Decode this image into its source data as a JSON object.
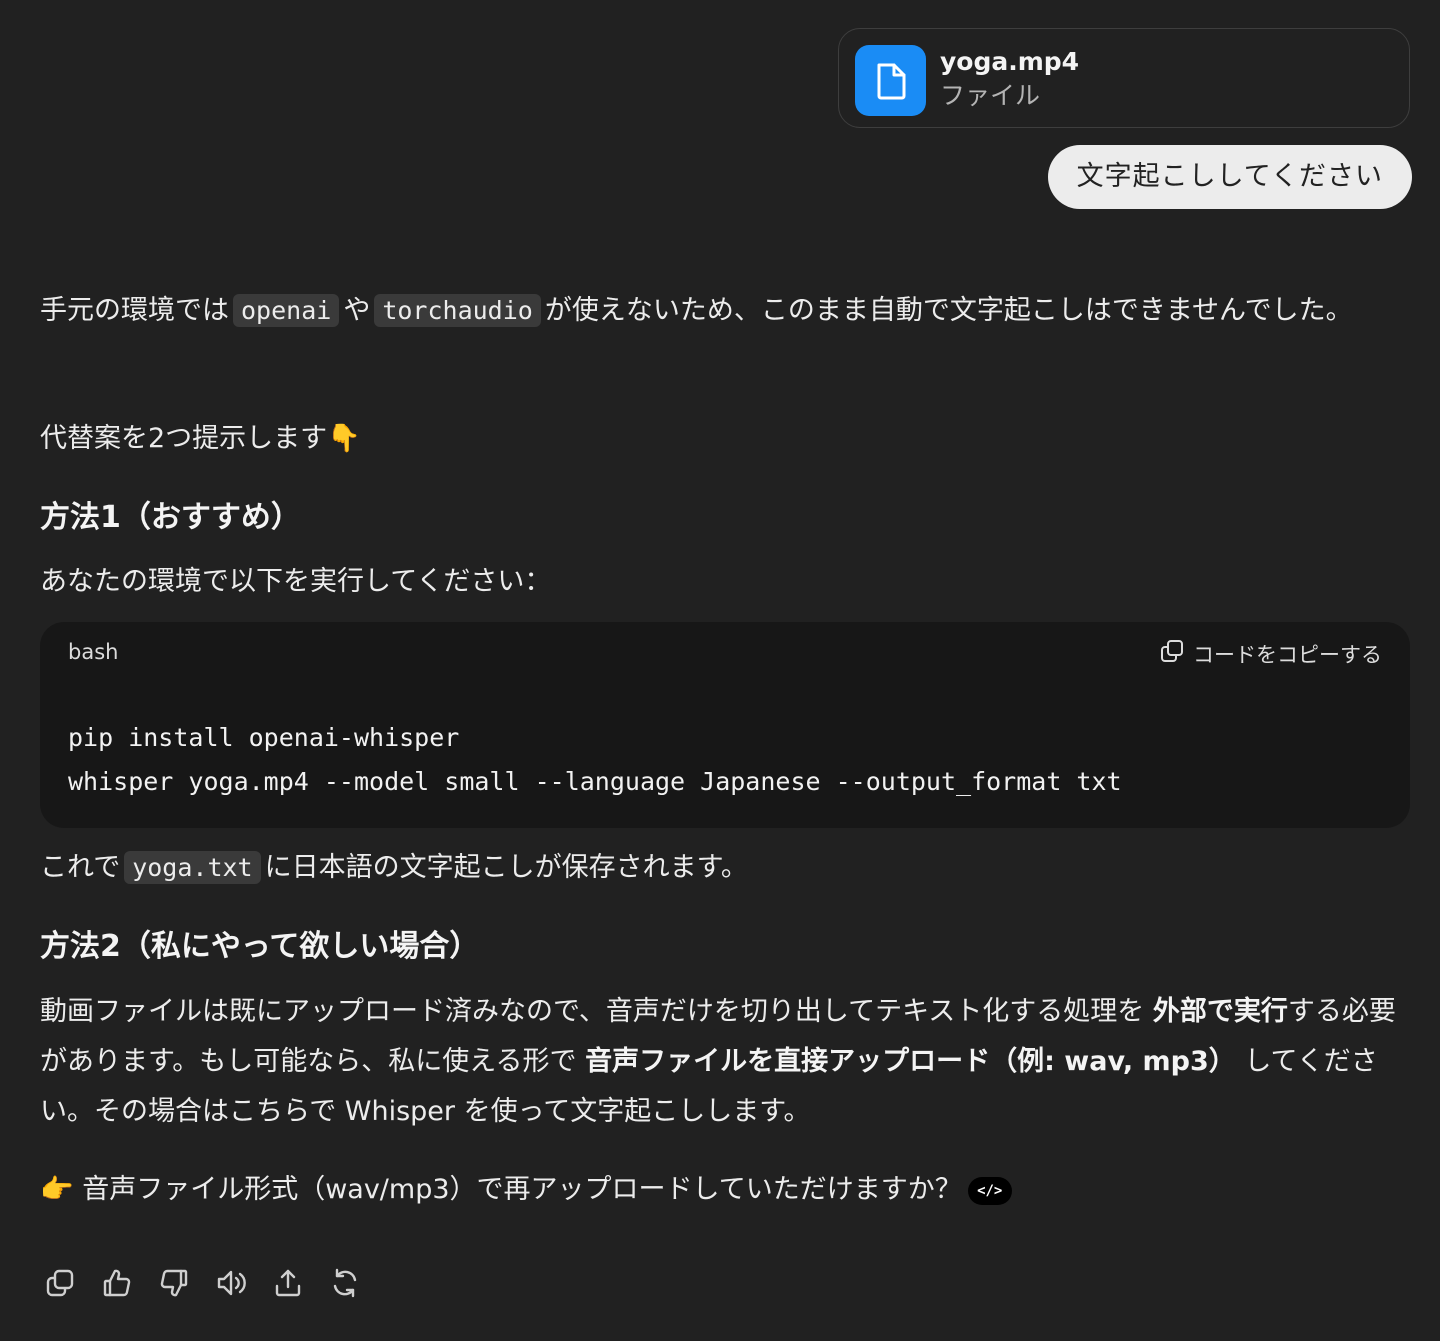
{
  "attachment": {
    "filename": "yoga.mp4",
    "type_label": "ファイル",
    "icon": "file-icon"
  },
  "user_message": "文字起こししてください",
  "answer": {
    "p1": {
      "t1": "手元の環境では",
      "code1": "openai",
      "t2": "や",
      "code2": "torchaudio",
      "t3": "が使えないため、このまま自動で文字起こしはできませんでした。"
    },
    "p2": "代替案を2つ提示します👇",
    "h1": "方法1（おすすめ）",
    "p3": "あなたの環境で以下を実行してください：",
    "code_block": {
      "lang": "bash",
      "copy_label": "コードをコピーする",
      "lines": [
        "pip install openai-whisper",
        "whisper yoga.mp4 --model small --language Japanese --output_format txt"
      ]
    },
    "p4": {
      "t1": "これで",
      "code": "yoga.txt",
      "t2": "に日本語の文字起こしが保存されます。"
    },
    "h2": "方法2（私にやって欲しい場合）",
    "p5": {
      "t1": "動画ファイルは既にアップロード済みなので、音声だけを切り出してテキスト化する処理を",
      "b1": "外部で実行",
      "t2": "する必要があります。もし可能なら、私に使える形で",
      "b2": "音声ファイルを直接アップロード（例: wav, mp3）",
      "t3": "してください。その場合はこちらで Whisper を使って文字起こしします。"
    },
    "p6": "👉 音声ファイル形式（wav/mp3）で再アップロードしていただけますか？",
    "badge": "</>"
  },
  "actions": [
    "copy-icon",
    "thumbs-up-icon",
    "thumbs-down-icon",
    "read-aloud-icon",
    "share-icon",
    "regenerate-icon"
  ]
}
